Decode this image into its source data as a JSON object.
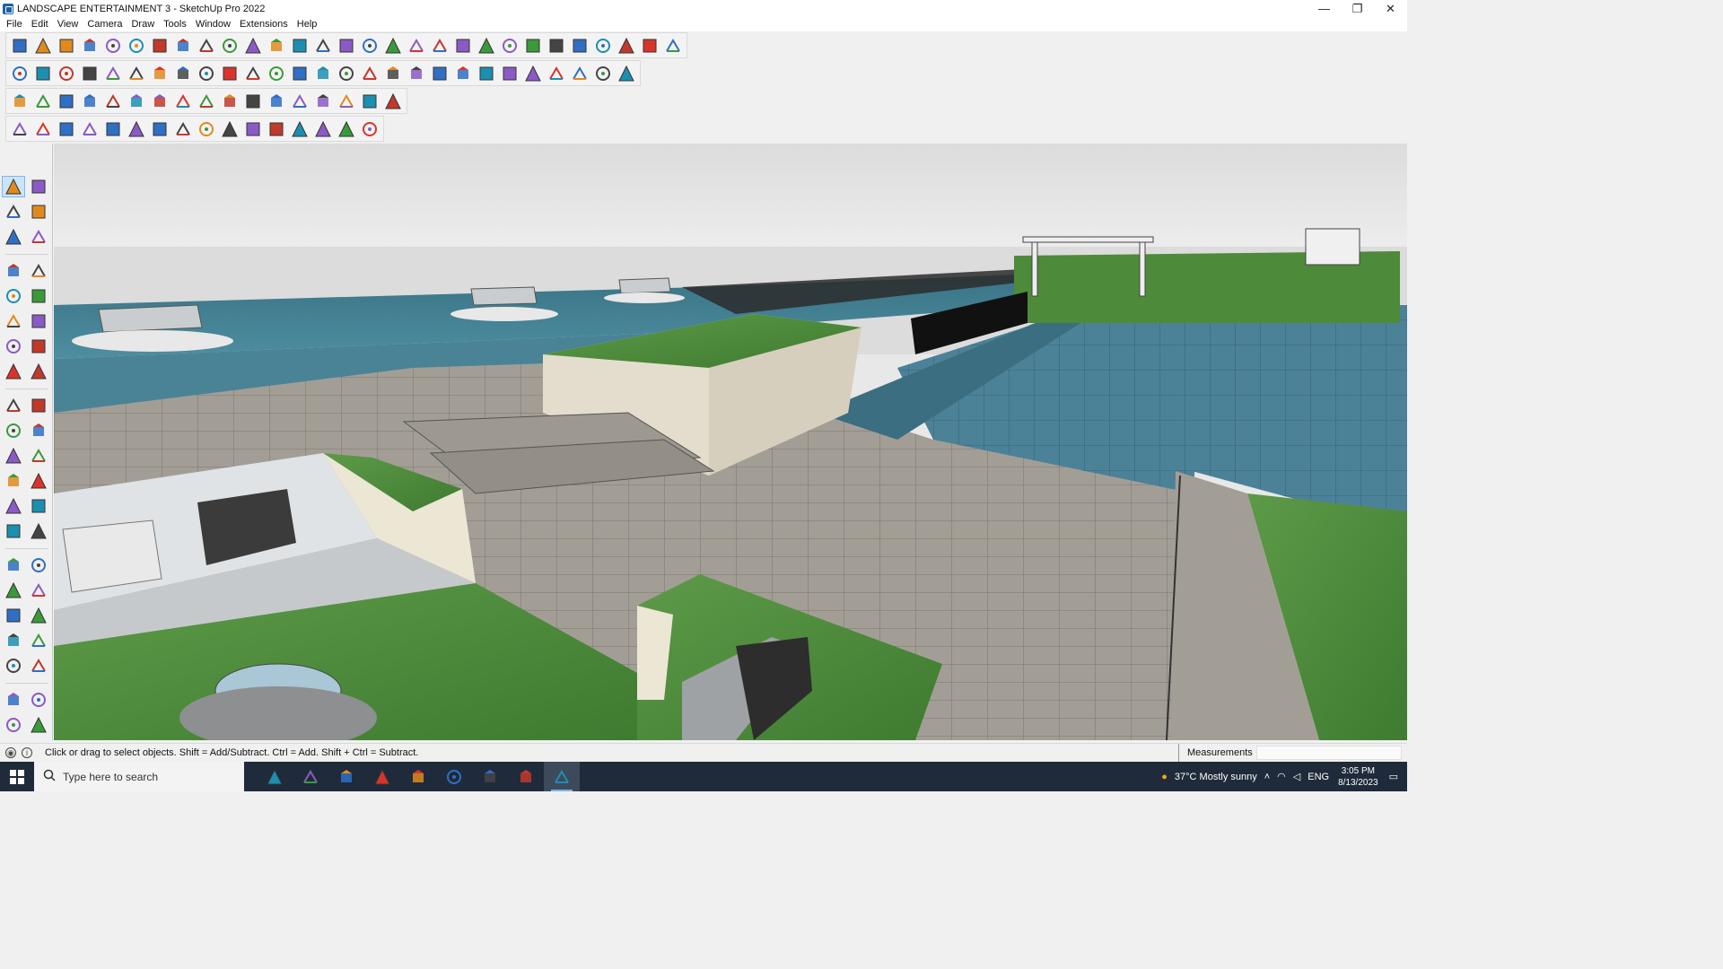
{
  "window": {
    "title": "LANDSCAPE ENTERTAINMENT 3 - SketchUp Pro 2022",
    "controls": {
      "minimize": "—",
      "maximize": "❐",
      "close": "✕"
    }
  },
  "menu": [
    "File",
    "Edit",
    "View",
    "Camera",
    "Draw",
    "Tools",
    "Window",
    "Extensions",
    "Help"
  ],
  "toolbars": {
    "row1_icons": [
      "zoom-extents-icon",
      "select-icon",
      "eraser-icon",
      "line-icon",
      "arc-icon",
      "rectangle-icon",
      "push-pull-icon",
      "follow-me-icon",
      "move-icon",
      "rotate-icon",
      "scale-icon",
      "tape-measure-icon",
      "text-icon",
      "paint-bucket-icon",
      "orbit-icon",
      "pan-icon",
      "zoom-icon",
      "zoom-window-icon",
      "section-plane-icon",
      "section-display-icon",
      "section-fill-icon",
      "layers-icon",
      "user-icon",
      "warehouse-icon",
      "extension-warehouse-icon",
      "send-to-layout-icon",
      "undo-icon",
      "redo-icon",
      "flip-icon"
    ],
    "row2_icons": [
      "shaded-box-icon",
      "x-ray-icon",
      "back-edges-icon",
      "axes-red-icon",
      "axes-blue-icon",
      "axes-green-icon",
      "axes-orange-icon",
      "top-view-icon",
      "front-view-icon",
      "right-view-icon",
      "back-view-icon",
      "left-view-icon",
      "iso-view-icon",
      "sandbox-icon",
      "smoove-icon",
      "house-icon",
      "house-front-icon",
      "house-roof-icon",
      "camera-icon",
      "leaf-icon",
      "pencil-icon",
      "polygon-icon",
      "shapes-icon",
      "measure-icon",
      "eraser-pink-icon",
      "model-icon",
      "terrain-icon"
    ],
    "row3_icons": [
      "face-icon",
      "solid-icon",
      "intersect-icon",
      "union-icon",
      "subtract-icon",
      "trim-icon",
      "split-icon",
      "outer-shell-icon",
      "offset-icon",
      "round-corner-icon",
      "spline-icon",
      "joint-push-icon",
      "vertex-tools-icon",
      "fredo-scale-icon",
      "curviloft-icon",
      "bezier-icon",
      "tools-grid-icon"
    ],
    "row4_icons": [
      "draw-spline-icon",
      "weld-icon",
      "extrude-icon",
      "cut-icon",
      "sphere-icon",
      "shape-bender-icon",
      "curve-icon",
      "box-icon",
      "hatch-icon",
      "profile-icon",
      "stairs-icon",
      "roof-icon",
      "frame-icon",
      "wall-icon",
      "fence-icon",
      "grid-icon"
    ]
  },
  "palette_icons": [
    "select-icon",
    "orbit-icon",
    "paint-bucket-icon",
    "eraser-icon",
    "component-icon",
    "tag-icon",
    "line-icon",
    "freehand-icon",
    "rectangle-icon",
    "rotated-rectangle-icon",
    "circle-icon",
    "polygon-icon",
    "arc-icon",
    "two-point-arc-icon",
    "three-point-arc-icon",
    "pie-icon",
    "move-icon",
    "push-pull-icon",
    "rotate-icon",
    "follow-me-icon",
    "scale-icon",
    "offset-icon",
    "tape-measure-icon",
    "dimension-icon",
    "protractor-icon",
    "text-icon",
    "axes-icon",
    "3d-text-icon",
    "orbit-tool-icon",
    "pan-icon",
    "zoom-icon",
    "zoom-window-icon",
    "zoom-extents-icon",
    "previous-view-icon",
    "position-camera-icon",
    "look-around-icon",
    "walk-icon",
    "section-plane-icon",
    "display-section-icon",
    "section-cut-icon",
    "layers-icon",
    "section-fill-icon"
  ],
  "status": {
    "message": "Click or drag to select objects. Shift = Add/Subtract. Ctrl = Add. Shift + Ctrl = Subtract.",
    "measurements_label": "Measurements",
    "measurements_value": ""
  },
  "taskbar": {
    "search_placeholder": "Type here to search",
    "apps": [
      "task-view-icon",
      "calculator-icon",
      "file-explorer-icon",
      "acrobat-icon",
      "teams-icon",
      "edge-icon",
      "sticky-notes-icon",
      "sketchup-layout-icon",
      "sketchup-icon"
    ],
    "weather": "37°C  Mostly sunny",
    "language": "ENG",
    "time": "3:05 PM",
    "date": "8/13/2023"
  },
  "colors": {
    "sky": "#e6e6e6",
    "water": "#3f7d92",
    "grass": "#4d8a3a",
    "paving": "#a8a39a",
    "stone_wall": "#e6dfcf",
    "taskbar": "#1f2b3a"
  }
}
